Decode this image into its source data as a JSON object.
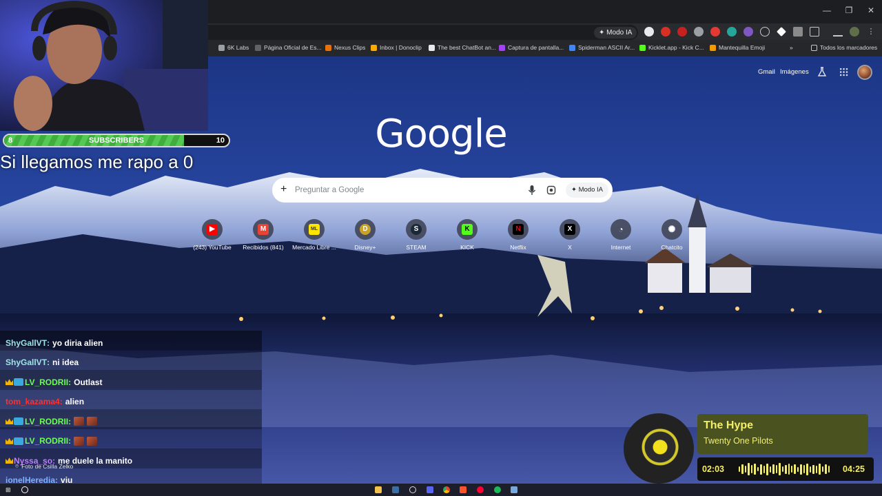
{
  "browser": {
    "omnibox_mode": "Modo IA",
    "bookmarks": [
      {
        "label": "6K Labs",
        "color": "#9aa0a6"
      },
      {
        "label": "Página Oficial de Es...",
        "color": "#5f6368"
      },
      {
        "label": "Nexus Clips",
        "color": "#e8710a"
      },
      {
        "label": "Inbox | Donoclip",
        "color": "#f9ab00"
      },
      {
        "label": "The best ChatBot an...",
        "color": "#e8eaed"
      },
      {
        "label": "Captura de pantalla...",
        "color": "#a142f4"
      },
      {
        "label": "Spiderman ASCII Ar...",
        "color": "#4285f4"
      },
      {
        "label": "Kicklet.app - Kick C...",
        "color": "#53fc18"
      },
      {
        "label": "Mantequilla Emoji",
        "color": "#f29900"
      }
    ],
    "more_bookmarks": "»",
    "all_bookmarks": "Todos los marcadores"
  },
  "google": {
    "gmail": "Gmail",
    "images": "Imágenes",
    "logo": "Google",
    "search_placeholder": "Preguntar a Google",
    "mode_button": "Modo IA",
    "shortcuts": [
      {
        "label": "(243) YouTube",
        "icon": "youtube-icon",
        "color": "#ff0000",
        "glyph": "▶"
      },
      {
        "label": "Recibidos (841)",
        "icon": "gmail-icon",
        "color": "#ea4335",
        "glyph": "M"
      },
      {
        "label": "Mercado Libre ...",
        "icon": "mercadolibre-icon",
        "color": "#ffe600",
        "glyph": "ML"
      },
      {
        "label": "Disney+",
        "icon": "disney-icon",
        "color": "#c9a227",
        "glyph": "D"
      },
      {
        "label": "STEAM",
        "icon": "steam-icon",
        "color": "#1b2838",
        "glyph": "S"
      },
      {
        "label": "KICK",
        "icon": "kick-icon",
        "color": "#53fc18",
        "glyph": "K"
      },
      {
        "label": "Netflix",
        "icon": "netflix-icon",
        "color": "#e50914",
        "glyph": "N"
      },
      {
        "label": "X",
        "icon": "x-icon",
        "color": "#000000",
        "glyph": "X"
      },
      {
        "label": "Internet",
        "icon": "speedometer-icon",
        "color": "#3c4043",
        "glyph": "◔"
      },
      {
        "label": "Chatcito",
        "icon": "chatgpt-icon",
        "color": "#3c4043",
        "glyph": "✺"
      }
    ],
    "photo_credit": "Foto de Csilla Zelko"
  },
  "stream": {
    "subscribers": {
      "current": "8",
      "label": "SUBSCRIBERS",
      "goal": "10",
      "progress": 0.8
    },
    "goal_text": "Si llegamos me rapo a 0",
    "chat": [
      {
        "user": "ShyGallVT",
        "color": "#9ee6e6",
        "crown": false,
        "badge": false,
        "message": "yo diria alien",
        "emotes": 0
      },
      {
        "user": "ShyGallVT",
        "color": "#9ee6e6",
        "crown": false,
        "badge": false,
        "message": "ni idea",
        "emotes": 0
      },
      {
        "user": "LV_RODRII",
        "color": "#6cff52",
        "crown": true,
        "badge": true,
        "message": "Outlast",
        "emotes": 0
      },
      {
        "user": "tom_kazama4",
        "color": "#ff3030",
        "crown": false,
        "badge": false,
        "message": "alien",
        "emotes": 0
      },
      {
        "user": "LV_RODRII",
        "color": "#6cff52",
        "crown": true,
        "badge": true,
        "message": "",
        "emotes": 2
      },
      {
        "user": "LV_RODRII",
        "color": "#6cff52",
        "crown": true,
        "badge": true,
        "message": "",
        "emotes": 2
      },
      {
        "user": "Nyssa_so",
        "color": "#c07cff",
        "crown": true,
        "badge": false,
        "message": "me duele la manito",
        "emotes": 0
      },
      {
        "user": "ionelHeredia",
        "color": "#7fb0ff",
        "crown": false,
        "badge": false,
        "message": "viu",
        "emotes": 0
      }
    ]
  },
  "now_playing": {
    "title": "The Hype",
    "artist": "Twenty One Pilots",
    "elapsed": "02:03",
    "total": "04:25",
    "progress": 0.464,
    "accent": "#f4ef2a"
  },
  "taskbar": {
    "apps": [
      "file-explorer-icon",
      "steam-icon",
      "obs-icon",
      "discord-icon",
      "chrome-icon",
      "brave-icon",
      "youtube-music-icon",
      "spotify-icon",
      "app-icon"
    ]
  }
}
